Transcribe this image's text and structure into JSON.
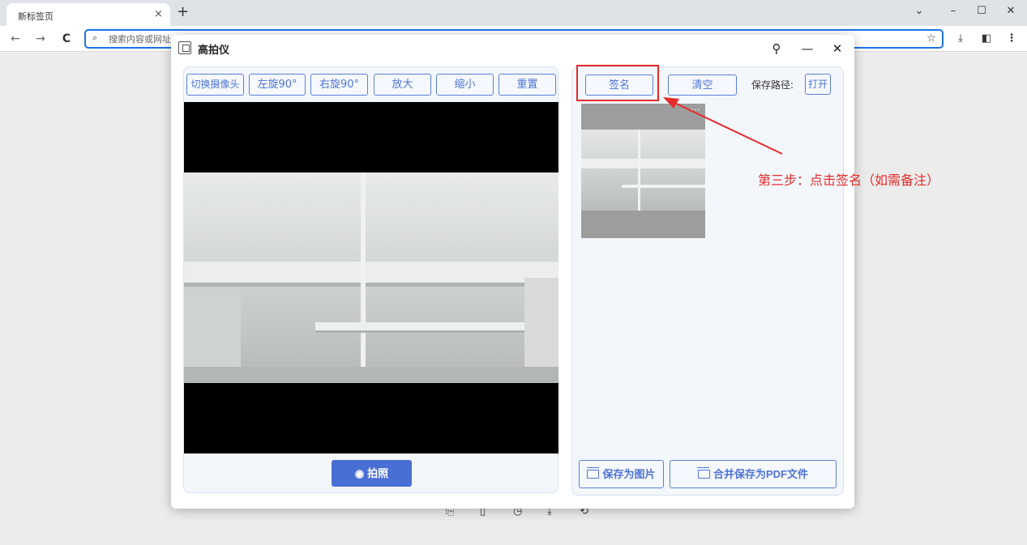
{
  "browser": {
    "tab_title": "新标签页",
    "tab_close": "×",
    "new_tab": "+",
    "address_placeholder": "搜索内容或网址",
    "window_controls": {
      "profile": "⌄",
      "minimize": "–",
      "maximize": "☐",
      "close": "✕"
    },
    "nav": {
      "back": "←",
      "forward": "→",
      "reload": "C"
    },
    "toolbar_icons": {
      "bookmark": "☆",
      "download": "⤓",
      "sidebar": "◧",
      "menu": "⋮"
    },
    "shortcut_icons": [
      "⎘",
      "▯",
      "◷",
      "⤓",
      "⟲"
    ]
  },
  "dialog": {
    "title": "高拍仪",
    "controls": {
      "pin": "⚲",
      "minimize": "—",
      "close": "✕"
    },
    "camera_toolbar": [
      "切换摄像头",
      "左旋90°",
      "右旋90°",
      "放大",
      "缩小",
      "重置"
    ],
    "capture_label": "拍照",
    "capture_icon": "◉",
    "right": {
      "sign_label": "签名",
      "clear_label": "清空",
      "save_path_label": "保存路径:",
      "open_label": "打开",
      "thumb_dots": "···",
      "save_image_label": "保存为图片",
      "save_pdf_label": "合并保存为PDF文件"
    }
  },
  "annotation": {
    "text": "第三步：点击签名（如需备注）",
    "color": "#e52b2b"
  },
  "colors": {
    "accent": "#4a6fd4",
    "button_border": "#5b7fd8",
    "panel_bg": "#f3f7fc",
    "omnibox_border": "#1a73e8"
  }
}
